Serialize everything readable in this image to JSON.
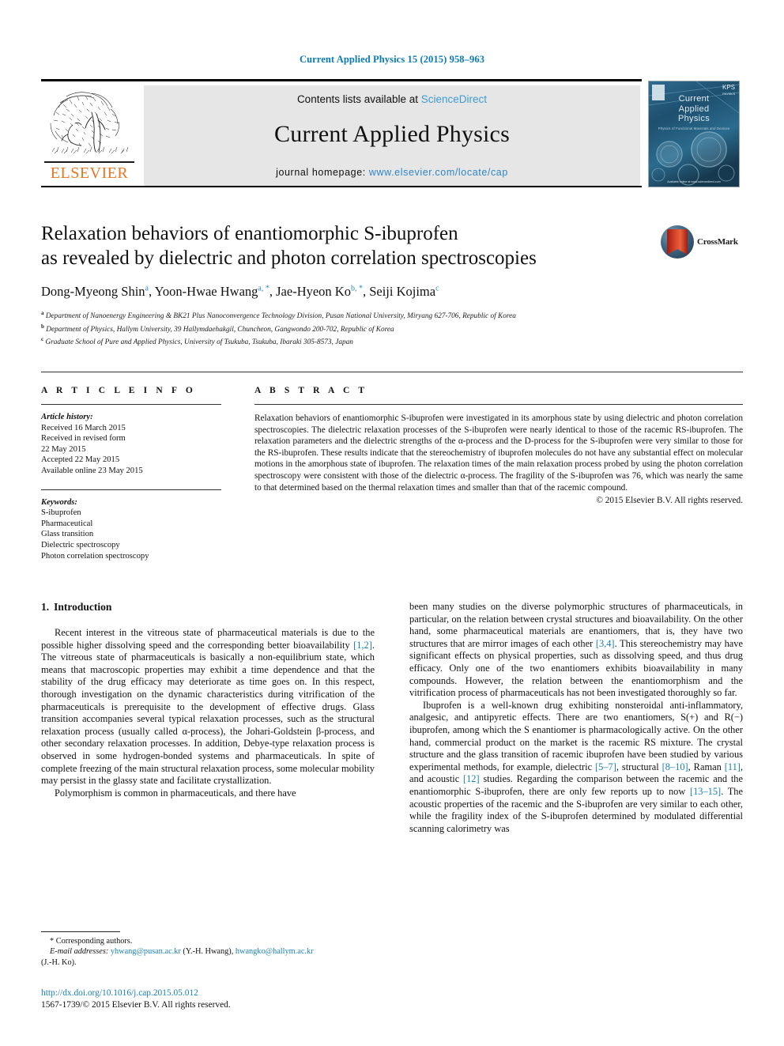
{
  "running_head": "Current Applied Physics 15 (2015) 958–963",
  "masthead": {
    "contents_prefix": "Contents lists available at ",
    "sciencedirect": "ScienceDirect",
    "journal_title": "Current Applied Physics",
    "homepage_prefix": "journal homepage: ",
    "homepage_url": "www.elsevier.com/locate/cap",
    "publisher": "ELSEVIER",
    "cover": {
      "title_line1": "Current",
      "title_line2": "Applied",
      "title_line3": "Physics",
      "subtitle": "Physics of Functional Materials and Devices",
      "kps": "KPS",
      "kps_sub": "PHYSICS",
      "bottom": "Available online at www.sciencedirect.com"
    },
    "accent_link_color": "#3f9bd0",
    "elsevier_orange": "#e87722"
  },
  "article": {
    "title_line1": "Relaxation behaviors of enantiomorphic S-ibuprofen",
    "title_line2": "as revealed by dielectric and photon correlation spectroscopies",
    "crossmark_label": "CrossMark",
    "authors": [
      {
        "name": "Dong-Myeong Shin",
        "marks": "a"
      },
      {
        "name": "Yoon-Hwae Hwang",
        "marks": "a, *"
      },
      {
        "name": "Jae-Hyeon Ko",
        "marks": "b, *"
      },
      {
        "name": "Seiji Kojima",
        "marks": "c"
      }
    ],
    "affiliations": [
      {
        "mark": "a",
        "text": "Department of Nanoenergy Engineering & BK21 Plus Nanoconvergence Technology Division, Pusan National University, Miryang 627-706, Republic of Korea"
      },
      {
        "mark": "b",
        "text": "Department of Physics, Hallym University, 39 Hallymdaehakgil, Chuncheon, Gangwondo 200-702, Republic of Korea"
      },
      {
        "mark": "c",
        "text": "Graduate School of Pure and Applied Physics, University of Tsukuba, Tsukuba, Ibaraki 305-8573, Japan"
      }
    ]
  },
  "article_info": {
    "heading": "A R T I C L E  I N F O",
    "history_label": "Article history:",
    "history": [
      "Received 16 March 2015",
      "Received in revised form",
      "22 May 2015",
      "Accepted 22 May 2015",
      "Available online 23 May 2015"
    ],
    "keywords_label": "Keywords:",
    "keywords": [
      "S-ibuprofen",
      "Pharmaceutical",
      "Glass transition",
      "Dielectric spectroscopy",
      "Photon correlation spectroscopy"
    ]
  },
  "abstract": {
    "heading": "A B S T R A C T",
    "text": "Relaxation behaviors of enantiomorphic S-ibuprofen were investigated in its amorphous state by using dielectric and photon correlation spectroscopies. The dielectric relaxation processes of the S-ibuprofen were nearly identical to those of the racemic RS-ibuprofen. The relaxation parameters and the dielectric strengths of the α-process and the D-process for the S-ibuprofen were very similar to those for the RS-ibuprofen. These results indicate that the stereochemistry of ibuprofen molecules do not have any substantial effect on molecular motions in the amorphous state of ibuprofen. The relaxation times of the main relaxation process probed by using the photon correlation spectroscopy were consistent with those of the dielectric α-process. The fragility of the S-ibuprofen was 76, which was nearly the same to that determined based on the thermal relaxation times and smaller than that of the racemic compound.",
    "copyright": "© 2015 Elsevier B.V. All rights reserved."
  },
  "body": {
    "section_number": "1.",
    "section_title": "Introduction",
    "left_paragraphs": [
      "Recent interest in the vitreous state of pharmaceutical materials is due to the possible higher dissolving speed and the corresponding better bioavailability [1,2]. The vitreous state of pharmaceuticals is basically a non-equilibrium state, which means that macroscopic properties may exhibit a time dependence and that the stability of the drug efficacy may deteriorate as time goes on. In this respect, thorough investigation on the dynamic characteristics during vitrification of the pharmaceuticals is prerequisite to the development of effective drugs. Glass transition accompanies several typical relaxation processes, such as the structural relaxation process (usually called α-process), the Johari-Goldstein β-process, and other secondary relaxation processes. In addition, Debye-type relaxation process is observed in some hydrogen-bonded systems and pharmaceuticals. In spite of complete freezing of the main structural relaxation process, some molecular mobility may persist in the glassy state and facilitate crystallization.",
      "Polymorphism is common in pharmaceuticals, and there have"
    ],
    "right_paragraphs": [
      "been many studies on the diverse polymorphic structures of pharmaceuticals, in particular, on the relation between crystal structures and bioavailability. On the other hand, some pharmaceutical materials are enantiomers, that is, they have two structures that are mirror images of each other [3,4]. This stereochemistry may have significant effects on physical properties, such as dissolving speed, and thus drug efficacy. Only one of the two enantiomers exhibits bioavailability in many compounds. However, the relation between the enantiomorphism and the vitrification process of pharmaceuticals has not been investigated thoroughly so far.",
      "Ibuprofen is a well-known drug exhibiting nonsteroidal anti-inflammatory, analgesic, and antipyretic effects. There are two enantiomers, S(+) and R(−) ibuprofen, among which the S enantiomer is pharmacologically active. On the other hand, commercial product on the market is the racemic RS mixture. The crystal structure and the glass transition of racemic ibuprofen have been studied by various experimental methods, for example, dielectric [5–7], structural [8–10], Raman [11], and acoustic [12] studies. Regarding the comparison between the racemic and the enantiomorphic S-ibuprofen, there are only few reports up to now [13–15]. The acoustic properties of the racemic and the S-ibuprofen are very similar to each other, while the fragility index of the S-ibuprofen determined by modulated differential scanning calorimetry was"
    ],
    "reference_color": "#1a7fb5"
  },
  "footnote": {
    "corresponding": "* Corresponding authors.",
    "email_label": "E-mail addresses:",
    "email1": "yhwang@pusan.ac.kr",
    "email1_owner": "(Y.-H. Hwang),",
    "email2": "hwangko@hallym.ac.kr",
    "email2_owner": "(J.-H. Ko)."
  },
  "doi_block": {
    "doi": "http://dx.doi.org/10.1016/j.cap.2015.05.012",
    "issn": "1567-1739/© 2015 Elsevier B.V. All rights reserved."
  }
}
